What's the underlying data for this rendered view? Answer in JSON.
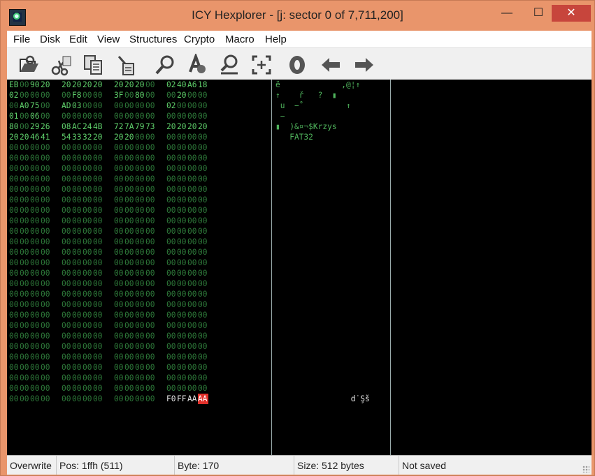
{
  "window": {
    "title": "ICY Hexplorer - [j: sector 0 of 7,711,200]",
    "min_glyph": "—",
    "max_glyph": "☐",
    "close_glyph": "✕"
  },
  "menu": [
    "File",
    "Disk",
    "Edit",
    "View",
    "Structures",
    "Crypto",
    "Macro",
    "Help"
  ],
  "toolbar": [
    {
      "name": "open-disk-icon"
    },
    {
      "name": "cut-icon"
    },
    {
      "name": "copy-icon"
    },
    {
      "name": "paste-icon"
    },
    {
      "name": "find-icon"
    },
    {
      "name": "find-replace-icon"
    },
    {
      "name": "goto-icon"
    },
    {
      "name": "select-block-icon"
    },
    {
      "name": "zero-icon"
    },
    {
      "name": "back-arrow-icon"
    },
    {
      "name": "forward-arrow-icon"
    }
  ],
  "hex_rows": [
    [
      "EB",
      "00",
      "90",
      "20",
      "20",
      "20",
      "20",
      "20",
      "20",
      "20",
      "20",
      "00",
      "02",
      "40",
      "A6",
      "18"
    ],
    [
      "02",
      "00",
      "00",
      "00",
      "00",
      "F8",
      "00",
      "00",
      "3F",
      "00",
      "80",
      "00",
      "00",
      "20",
      "00",
      "00"
    ],
    [
      "00",
      "A0",
      "75",
      "00",
      "AD",
      "03",
      "00",
      "00",
      "00",
      "00",
      "00",
      "00",
      "02",
      "00",
      "00",
      "00"
    ],
    [
      "01",
      "00",
      "06",
      "00",
      "00",
      "00",
      "00",
      "00",
      "00",
      "00",
      "00",
      "00",
      "00",
      "00",
      "00",
      "00"
    ],
    [
      "80",
      "00",
      "29",
      "26",
      "08",
      "AC",
      "24",
      "4B",
      "72",
      "7A",
      "79",
      "73",
      "20",
      "20",
      "20",
      "20"
    ],
    [
      "20",
      "20",
      "46",
      "41",
      "54",
      "33",
      "32",
      "20",
      "20",
      "20",
      "00",
      "00",
      "00",
      "00",
      "00",
      "00"
    ],
    [
      "00",
      "00",
      "00",
      "00",
      "00",
      "00",
      "00",
      "00",
      "00",
      "00",
      "00",
      "00",
      "00",
      "00",
      "00",
      "00"
    ],
    [
      "00",
      "00",
      "00",
      "00",
      "00",
      "00",
      "00",
      "00",
      "00",
      "00",
      "00",
      "00",
      "00",
      "00",
      "00",
      "00"
    ],
    [
      "00",
      "00",
      "00",
      "00",
      "00",
      "00",
      "00",
      "00",
      "00",
      "00",
      "00",
      "00",
      "00",
      "00",
      "00",
      "00"
    ],
    [
      "00",
      "00",
      "00",
      "00",
      "00",
      "00",
      "00",
      "00",
      "00",
      "00",
      "00",
      "00",
      "00",
      "00",
      "00",
      "00"
    ],
    [
      "00",
      "00",
      "00",
      "00",
      "00",
      "00",
      "00",
      "00",
      "00",
      "00",
      "00",
      "00",
      "00",
      "00",
      "00",
      "00"
    ],
    [
      "00",
      "00",
      "00",
      "00",
      "00",
      "00",
      "00",
      "00",
      "00",
      "00",
      "00",
      "00",
      "00",
      "00",
      "00",
      "00"
    ],
    [
      "00",
      "00",
      "00",
      "00",
      "00",
      "00",
      "00",
      "00",
      "00",
      "00",
      "00",
      "00",
      "00",
      "00",
      "00",
      "00"
    ],
    [
      "00",
      "00",
      "00",
      "00",
      "00",
      "00",
      "00",
      "00",
      "00",
      "00",
      "00",
      "00",
      "00",
      "00",
      "00",
      "00"
    ],
    [
      "00",
      "00",
      "00",
      "00",
      "00",
      "00",
      "00",
      "00",
      "00",
      "00",
      "00",
      "00",
      "00",
      "00",
      "00",
      "00"
    ],
    [
      "00",
      "00",
      "00",
      "00",
      "00",
      "00",
      "00",
      "00",
      "00",
      "00",
      "00",
      "00",
      "00",
      "00",
      "00",
      "00"
    ],
    [
      "00",
      "00",
      "00",
      "00",
      "00",
      "00",
      "00",
      "00",
      "00",
      "00",
      "00",
      "00",
      "00",
      "00",
      "00",
      "00"
    ],
    [
      "00",
      "00",
      "00",
      "00",
      "00",
      "00",
      "00",
      "00",
      "00",
      "00",
      "00",
      "00",
      "00",
      "00",
      "00",
      "00"
    ],
    [
      "00",
      "00",
      "00",
      "00",
      "00",
      "00",
      "00",
      "00",
      "00",
      "00",
      "00",
      "00",
      "00",
      "00",
      "00",
      "00"
    ],
    [
      "00",
      "00",
      "00",
      "00",
      "00",
      "00",
      "00",
      "00",
      "00",
      "00",
      "00",
      "00",
      "00",
      "00",
      "00",
      "00"
    ],
    [
      "00",
      "00",
      "00",
      "00",
      "00",
      "00",
      "00",
      "00",
      "00",
      "00",
      "00",
      "00",
      "00",
      "00",
      "00",
      "00"
    ],
    [
      "00",
      "00",
      "00",
      "00",
      "00",
      "00",
      "00",
      "00",
      "00",
      "00",
      "00",
      "00",
      "00",
      "00",
      "00",
      "00"
    ],
    [
      "00",
      "00",
      "00",
      "00",
      "00",
      "00",
      "00",
      "00",
      "00",
      "00",
      "00",
      "00",
      "00",
      "00",
      "00",
      "00"
    ],
    [
      "00",
      "00",
      "00",
      "00",
      "00",
      "00",
      "00",
      "00",
      "00",
      "00",
      "00",
      "00",
      "00",
      "00",
      "00",
      "00"
    ],
    [
      "00",
      "00",
      "00",
      "00",
      "00",
      "00",
      "00",
      "00",
      "00",
      "00",
      "00",
      "00",
      "00",
      "00",
      "00",
      "00"
    ],
    [
      "00",
      "00",
      "00",
      "00",
      "00",
      "00",
      "00",
      "00",
      "00",
      "00",
      "00",
      "00",
      "00",
      "00",
      "00",
      "00"
    ],
    [
      "00",
      "00",
      "00",
      "00",
      "00",
      "00",
      "00",
      "00",
      "00",
      "00",
      "00",
      "00",
      "00",
      "00",
      "00",
      "00"
    ],
    [
      "00",
      "00",
      "00",
      "00",
      "00",
      "00",
      "00",
      "00",
      "00",
      "00",
      "00",
      "00",
      "00",
      "00",
      "00",
      "00"
    ],
    [
      "00",
      "00",
      "00",
      "00",
      "00",
      "00",
      "00",
      "00",
      "00",
      "00",
      "00",
      "00",
      "00",
      "00",
      "00",
      "00"
    ],
    [
      "00",
      "00",
      "00",
      "00",
      "00",
      "00",
      "00",
      "00",
      "00",
      "00",
      "00",
      "00",
      "00",
      "00",
      "00",
      "00"
    ],
    [
      "00",
      "00",
      "00",
      "00",
      "00",
      "00",
      "00",
      "00",
      "00",
      "00",
      "00",
      "00",
      "F0",
      "FF",
      "AA",
      "AA"
    ]
  ],
  "ascii_rows": [
    "ë             ,@¦↑",
    "↑    ř   ?  ▮",
    " u  −˚         ↑",
    " −",
    "▮  )&¤¬$Krzys",
    "   FAT32",
    "",
    "",
    "",
    "",
    "",
    "",
    "",
    "",
    "",
    "",
    "",
    "",
    "",
    "",
    "",
    "",
    "",
    "",
    "",
    "",
    "",
    "",
    "",
    "",
    "                d˙Şš"
  ],
  "status": {
    "mode": "Overwrite",
    "pos": "Pos: 1ffh (511)",
    "byte": "Byte: 170",
    "size": "Size: 512 bytes",
    "saved": "Not saved"
  },
  "colors": {
    "title_bar": "#e9956b",
    "close_button": "#c7453c",
    "hex_dim": "#2e7a3a",
    "hex_bright": "#5fd06b",
    "selection": "#e0302a"
  }
}
